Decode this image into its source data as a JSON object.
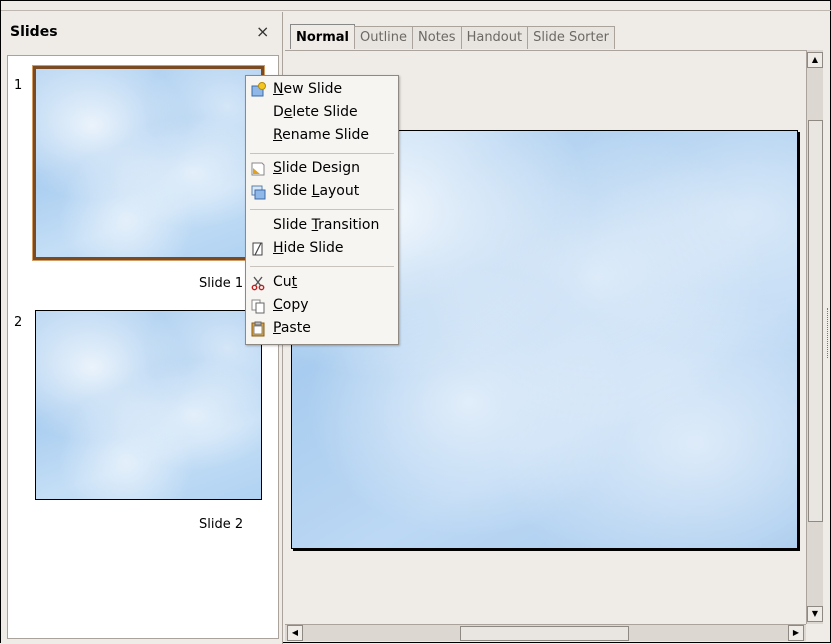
{
  "slides_pane": {
    "title": "Slides",
    "close_glyph": "×",
    "slides": [
      {
        "number": "1",
        "label": "Slide 1"
      },
      {
        "number": "2",
        "label": "Slide 2"
      }
    ]
  },
  "tabs": [
    "Normal",
    "Outline",
    "Notes",
    "Handout",
    "Slide Sorter"
  ],
  "context_menu": {
    "items": [
      {
        "pre": "",
        "key": "N",
        "post": "ew Slide",
        "icon": "new-slide-icon"
      },
      {
        "pre": "D",
        "key": "e",
        "post": "lete Slide",
        "icon": ""
      },
      {
        "pre": "",
        "key": "R",
        "post": "ename Slide",
        "icon": ""
      },
      {
        "pre": "",
        "key": "S",
        "post": "lide Design",
        "icon": "slide-design-icon"
      },
      {
        "pre": "Slide ",
        "key": "L",
        "post": "ayout",
        "icon": "slide-layout-icon"
      },
      {
        "pre": "Slide ",
        "key": "T",
        "post": "ransition",
        "icon": ""
      },
      {
        "pre": "",
        "key": "H",
        "post": "ide Slide",
        "icon": "hide-slide-icon"
      },
      {
        "pre": "Cu",
        "key": "t",
        "post": "",
        "icon": "scissors-icon"
      },
      {
        "pre": "",
        "key": "C",
        "post": "opy",
        "icon": "copy-icon"
      },
      {
        "pre": "",
        "key": "P",
        "post": "aste",
        "icon": "paste-icon"
      }
    ]
  },
  "scroll": {
    "up": "▲",
    "down": "▼",
    "left": "◀",
    "right": "▶"
  }
}
